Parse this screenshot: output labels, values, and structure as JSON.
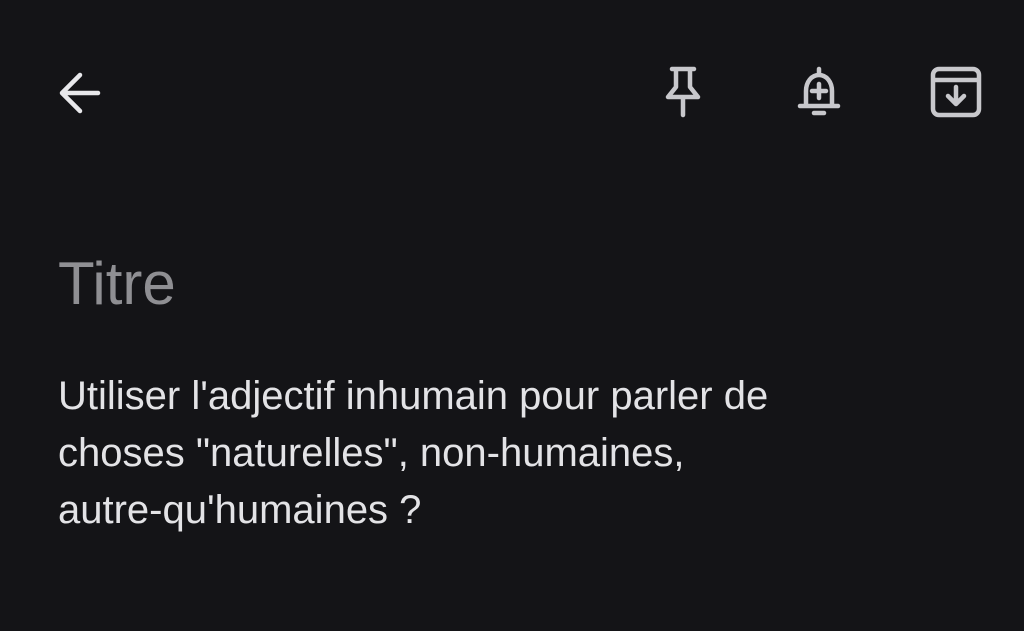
{
  "toolbar": {
    "back_icon": "arrow-back-icon",
    "pin_icon": "pin-icon",
    "reminder_icon": "add-alert-bell-icon",
    "archive_icon": "archive-icon"
  },
  "note": {
    "title_placeholder": "Titre",
    "title_value": "",
    "body": "Utiliser l'adjectif inhumain pour parler de\nchoses \"naturelles\", non-humaines,\nautre-qu'humaines ?"
  },
  "colors": {
    "background": "#141417",
    "text": "#e3e3e6",
    "placeholder": "#8f8f93",
    "icon": "#c8c8cc"
  }
}
